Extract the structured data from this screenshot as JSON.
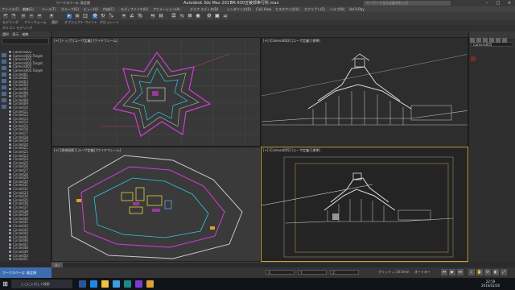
{
  "titlebar": {
    "app_title": "Autodesk 3ds Max 2017",
    "file_name": "BR-930五稜郭奉行所.max",
    "workspace_label": "ワークスペース: 既定値",
    "search_placeholder": "キーワードまたは語句を入力"
  },
  "menu": [
    "ファイル(F)",
    "編集(E)",
    "ツール(T)",
    "グループ(G)",
    "ビュー(V)",
    "作成(C)",
    "モディファイヤ(O)",
    "アニメーション(A)",
    "グラフ エディタ(D)",
    "レンダリング(R)",
    "Civil View",
    "カスタマイズ(U)",
    "スクリプト(S)",
    "ヘルプ(H)",
    "Vol V-Ray"
  ],
  "ribbon": {
    "tabs": [
      "モデリング",
      "フリーフォーム",
      "選択",
      "オブジェクト ペイント",
      "ポピュレート"
    ],
    "sub_tabs": [
      "ポリゴン モデリング"
    ],
    "scene_tabs": [
      "選択",
      "表示",
      "編集"
    ]
  },
  "scene_explorer": {
    "items": [
      "Camera002",
      "Camera002.Target",
      "Camera003",
      "Camera003.Target",
      "Camera005",
      "Camera005.Target",
      "Circle001",
      "Circle002",
      "Circle003",
      "Circle004",
      "Circle005",
      "Circle006",
      "Circle007",
      "Circle008",
      "Circle009",
      "Circle010",
      "Circle011",
      "Circle012",
      "Circle013",
      "Circle014",
      "Circle015",
      "Circle016",
      "Circle017",
      "Circle018",
      "Circle019",
      "Circle020",
      "Circle021",
      "Circle022",
      "Circle023",
      "Circle024",
      "Circle025",
      "Circle026",
      "Circle027",
      "Circle028",
      "Circle029",
      "Circle030",
      "Circle031",
      "Circle032",
      "Circle033",
      "Circle034",
      "Circle035",
      "Circle036",
      "Circle037",
      "Circle038",
      "Circle039",
      "Circle040",
      "Circle041",
      "Circle042",
      "Circle043",
      "Circle044",
      "Circle045",
      "Circle046",
      "Circle047",
      "Circle048",
      "Circle049",
      "Circle050",
      "Circle051"
    ],
    "footer_label": "ワークスペース: 既定値"
  },
  "viewports": {
    "top": "[+] [トップ] [ユーザ定義] [ワイヤフレーム]",
    "camera1": "[+] [Camera002] [ユーザ定義] [標準]",
    "perspective": "[+] [透視投影] [ユーザ定義] [ワイヤフレーム]",
    "camera2": "[+] [Camera005] [ユーザ定義] [標準]"
  },
  "command_panel": {
    "object_name": "Camera005"
  },
  "timeline": {
    "frame_label": "0 / 100"
  },
  "statusbar": {
    "grid_label": "グリッド = 10.0mm",
    "x": "X:",
    "y": "Y:",
    "z": "Z:",
    "key_label": "オートキー",
    "selected_label": "選択"
  },
  "taskbar": {
    "search_placeholder": "ここに入力して検索",
    "time": "22:59",
    "date": "2016/02/26"
  },
  "colors": {
    "accent": "#3d6db0",
    "active_viewport": "#c8a23a",
    "magenta": "#d63ad8",
    "cyan": "#2ec8e0"
  }
}
